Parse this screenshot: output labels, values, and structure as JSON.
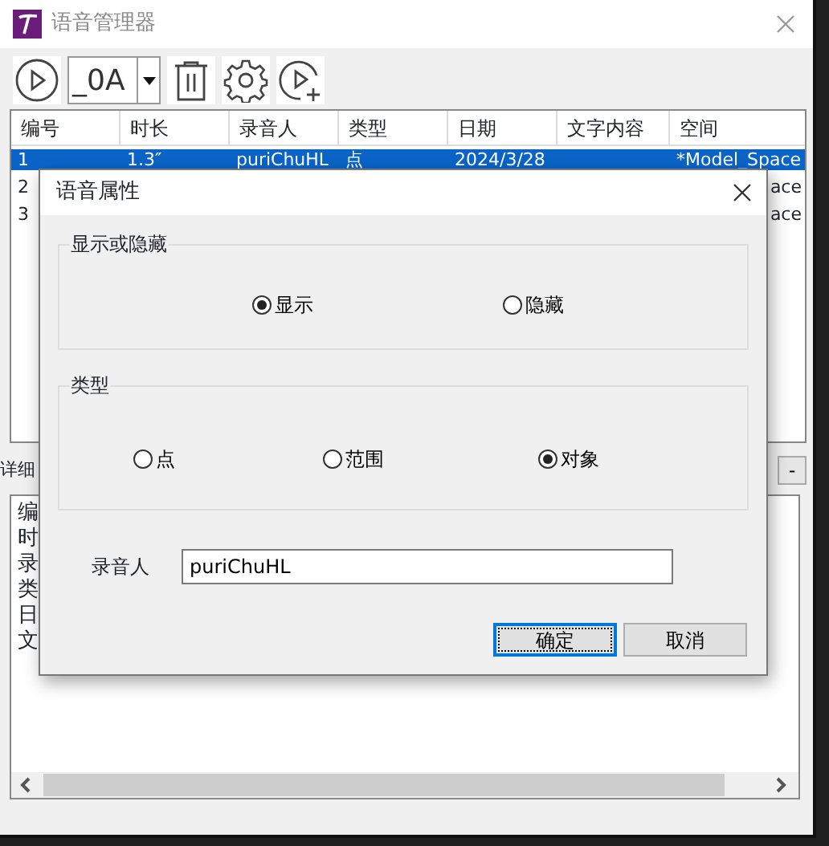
{
  "window": {
    "title": "语音管理器"
  },
  "toolbar": {
    "font_selector": "_0A"
  },
  "table": {
    "columns": [
      "编号",
      "时长",
      "录音人",
      "类型",
      "日期",
      "文字内容",
      "空间"
    ],
    "rows": [
      {
        "selected": true,
        "number": "1",
        "duration": "1.3″",
        "recorder": "puriChuHL",
        "type": "点",
        "date": "2024/3/28",
        "space": "*Model_Space"
      },
      {
        "selected": false,
        "number": "2",
        "space": "ace"
      },
      {
        "selected": false,
        "number": "3",
        "space": "ace"
      }
    ]
  },
  "details": {
    "label": "详细",
    "collapse_button": "-",
    "lines": [
      "编",
      "时",
      "录",
      "类",
      "日",
      "文"
    ]
  },
  "dialog": {
    "title": "语音属性",
    "groups": [
      {
        "title": "显示或隐藏",
        "options": [
          {
            "label": "显示",
            "selected": true
          },
          {
            "label": "隐藏",
            "selected": false
          }
        ]
      },
      {
        "title": "类型",
        "options": [
          {
            "label": "点",
            "selected": false
          },
          {
            "label": "范围",
            "selected": false
          },
          {
            "label": "对象",
            "selected": true
          }
        ]
      }
    ],
    "recorder": {
      "label": "录音人",
      "value": "puriChuHL"
    },
    "buttons": [
      {
        "label": "确定",
        "focused": true
      },
      {
        "label": "取消",
        "focused": false
      }
    ]
  }
}
